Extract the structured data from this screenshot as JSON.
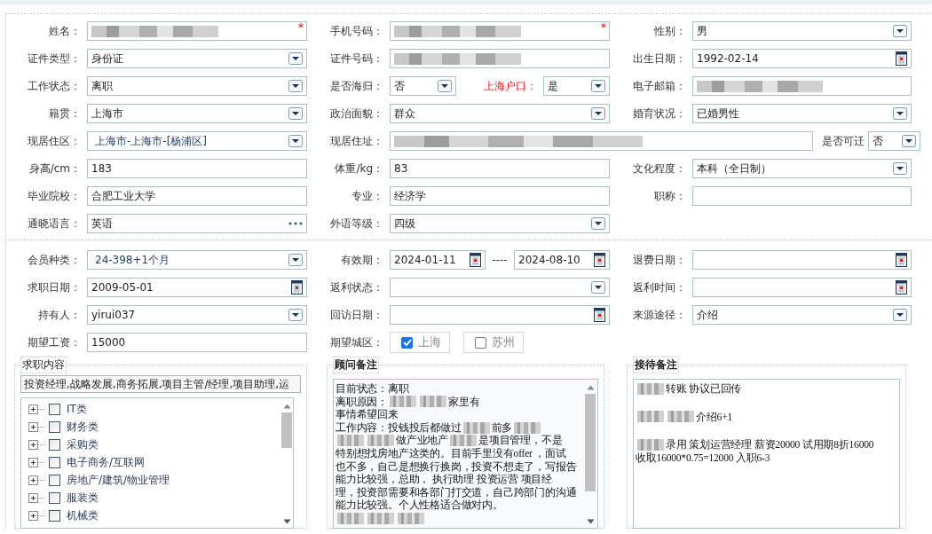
{
  "sections": [
    {
      "rows": [
        [
          {
            "label": "姓名：",
            "controls": [
              {
                "kind": "text",
                "redacted": true,
                "marker": "*"
              }
            ]
          },
          {
            "label": "手机号码：",
            "controls": [
              {
                "kind": "text",
                "redacted": true,
                "marker": "*"
              }
            ]
          },
          {
            "label": "性别：",
            "controls": [
              {
                "kind": "select",
                "value": "男"
              }
            ]
          }
        ],
        [
          {
            "label": "证件类型：",
            "controls": [
              {
                "kind": "select",
                "value": "身份证"
              }
            ]
          },
          {
            "label": "证件号码：",
            "controls": [
              {
                "kind": "text",
                "redacted": true
              }
            ]
          },
          {
            "label": "出生日期：",
            "controls": [
              {
                "kind": "date",
                "value": "1992-02-14"
              }
            ]
          }
        ],
        [
          {
            "label": "工作状态：",
            "controls": [
              {
                "kind": "select",
                "value": "离职"
              }
            ]
          },
          {
            "label": "是否海归：",
            "controls": [
              {
                "kind": "select",
                "value": "否"
              },
              {
                "kind": "label",
                "text": "上海户口：",
                "emphasis": true
              },
              {
                "kind": "select",
                "value": "是"
              }
            ]
          },
          {
            "label": "电子邮箱：",
            "controls": [
              {
                "kind": "text",
                "redacted": true
              }
            ]
          }
        ],
        [
          {
            "label": "籍贯：",
            "controls": [
              {
                "kind": "select",
                "value": "上海市"
              }
            ]
          },
          {
            "label": "政治面貌：",
            "controls": [
              {
                "kind": "select",
                "value": "群众"
              }
            ]
          },
          {
            "label": "婚育状况：",
            "controls": [
              {
                "kind": "select",
                "value": "已婚男性"
              }
            ]
          }
        ],
        [
          {
            "label": "现居住区：",
            "controls": [
              {
                "kind": "select",
                "value": "上海市-上海市-[杨浦区]",
                "linked": true
              }
            ]
          },
          {
            "label": "现居住址：",
            "controls": [
              {
                "kind": "text",
                "redacted": true
              }
            ]
          },
          {
            "label": "是否可迁",
            "trailing": true,
            "controls": [
              {
                "kind": "select",
                "value": "否"
              }
            ]
          }
        ],
        [
          {
            "label": "身高/cm：",
            "controls": [
              {
                "kind": "text",
                "value": "183"
              }
            ]
          },
          {
            "label": "体重/kg：",
            "controls": [
              {
                "kind": "text",
                "value": "83"
              }
            ]
          },
          {
            "label": "文化程度：",
            "controls": [
              {
                "kind": "select",
                "value": "本科（全日制）"
              }
            ]
          }
        ],
        [
          {
            "label": "毕业院校：",
            "controls": [
              {
                "kind": "text",
                "value": "合肥工业大学"
              }
            ]
          },
          {
            "label": "专业：",
            "controls": [
              {
                "kind": "text",
                "value": "经济学"
              }
            ]
          },
          {
            "label": "职称：",
            "controls": [
              {
                "kind": "text"
              }
            ]
          }
        ],
        [
          {
            "label": "通晓语言：",
            "controls": [
              {
                "kind": "picker",
                "value": "英语"
              }
            ]
          },
          {
            "label": "外语等级：",
            "controls": [
              {
                "kind": "select",
                "value": "四级"
              }
            ]
          }
        ]
      ]
    },
    {
      "rows": [
        [
          {
            "label": "会员种类：",
            "controls": [
              {
                "kind": "select",
                "value": "24-398+1个月",
                "linked": true
              }
            ]
          },
          {
            "label": "有效期：",
            "controls": [
              {
                "kind": "date",
                "value": "2024-01-11"
              },
              {
                "kind": "separator",
                "text": "----"
              },
              {
                "kind": "date",
                "value": "2024-08-10"
              }
            ]
          },
          {
            "label": "退费日期：",
            "controls": [
              {
                "kind": "date"
              }
            ]
          }
        ],
        [
          {
            "label": "求职日期：",
            "controls": [
              {
                "kind": "date",
                "value": "2009-05-01"
              }
            ]
          },
          {
            "label": "返利状态：",
            "controls": [
              {
                "kind": "select"
              }
            ]
          },
          {
            "label": "返利时间：",
            "controls": [
              {
                "kind": "date"
              }
            ]
          }
        ],
        [
          {
            "label": "持有人：",
            "controls": [
              {
                "kind": "select",
                "value": "yirui037"
              }
            ]
          },
          {
            "label": "回访日期：",
            "controls": [
              {
                "kind": "date"
              }
            ]
          },
          {
            "label": "来源途径：",
            "controls": [
              {
                "kind": "select",
                "value": "介绍"
              }
            ]
          }
        ],
        [
          {
            "label": "期望工资：",
            "controls": [
              {
                "kind": "text",
                "value": "15000"
              }
            ]
          },
          {
            "label": "期望城区：",
            "controls": [
              {
                "kind": "city",
                "text": "上海",
                "checked": true
              },
              {
                "kind": "city",
                "text": "苏州",
                "checked": false
              }
            ]
          }
        ]
      ]
    }
  ],
  "job_panel": {
    "title": "求职内容",
    "summary": "投资经理,战略发展,商务拓展,项目主管/经理,项目助理,运",
    "tree": [
      {
        "label": "IT类",
        "expanded": false,
        "checked": false
      },
      {
        "label": "财务类",
        "expanded": false,
        "checked": false
      },
      {
        "label": "采购类",
        "expanded": false,
        "checked": false
      },
      {
        "label": "电子商务/互联网",
        "expanded": false,
        "checked": false
      },
      {
        "label": "房地产/建筑/物业管理",
        "expanded": false,
        "checked": false
      },
      {
        "label": "服装类",
        "expanded": false,
        "checked": false
      },
      {
        "label": "机械类",
        "expanded": false,
        "checked": false
      }
    ]
  },
  "note_panels": [
    {
      "title": "顾问备注",
      "scrollable": true,
      "lines": [
        {
          "parts": [
            {
              "kind": "text",
              "text": "目前状态：离职"
            }
          ]
        },
        {
          "parts": [
            {
              "kind": "text",
              "text": "离职原因："
            },
            {
              "kind": "redacted"
            },
            {
              "kind": "redacted"
            },
            {
              "kind": "text",
              "text": "家里有"
            }
          ]
        },
        {
          "parts": [
            {
              "kind": "text",
              "text": "事情希望回来"
            }
          ]
        },
        {
          "parts": [
            {
              "kind": "text",
              "text": "工作内容：投钱投后都做过"
            },
            {
              "kind": "redacted"
            },
            {
              "kind": "text",
              "text": "前多"
            },
            {
              "kind": "redacted"
            }
          ]
        },
        {
          "parts": [
            {
              "kind": "redacted"
            },
            {
              "kind": "redacted"
            },
            {
              "kind": "text",
              "text": "做产业地产"
            },
            {
              "kind": "redacted"
            },
            {
              "kind": "text",
              "text": "是项目管理，不是"
            }
          ]
        },
        {
          "parts": [
            {
              "kind": "text",
              "text": "特别想找房地产这类的。目前手里没有offer ，面试"
            }
          ]
        },
        {
          "parts": [
            {
              "kind": "text",
              "text": "也不多，自己是想换行换岗，投资不想走了，写报告"
            }
          ]
        },
        {
          "parts": [
            {
              "kind": "text",
              "text": "能力比较强，总助， 执行助理 投资运营 项目经"
            }
          ]
        },
        {
          "parts": [
            {
              "kind": "text",
              "text": "理，投资部需要和各部门打交道，自己跨部门的沟通"
            }
          ]
        },
        {
          "parts": [
            {
              "kind": "text",
              "text": "能力比较强。个人性格适合做对内。"
            }
          ]
        },
        {
          "parts": [
            {
              "kind": "redacted"
            },
            {
              "kind": "redacted"
            },
            {
              "kind": "redacted"
            }
          ]
        }
      ]
    },
    {
      "title": "接待备注",
      "scrollable": false,
      "lines": [
        {
          "parts": [
            {
              "kind": "redacted"
            },
            {
              "kind": "text",
              "text": "转账 协议已回传"
            }
          ]
        },
        {
          "spaced": true,
          "parts": [
            {
              "kind": "redacted"
            },
            {
              "kind": "redacted"
            },
            {
              "kind": "text",
              "text": "介绍6+1"
            }
          ]
        },
        {
          "spaced": true,
          "parts": [
            {
              "kind": "redacted"
            },
            {
              "kind": "text",
              "text": "录用 策划运营经理  薪资20000  试用期8折16000"
            }
          ]
        },
        {
          "parts": [
            {
              "kind": "text",
              "text": "收取16000*0.75=12000  入职6-3"
            }
          ]
        }
      ]
    }
  ]
}
